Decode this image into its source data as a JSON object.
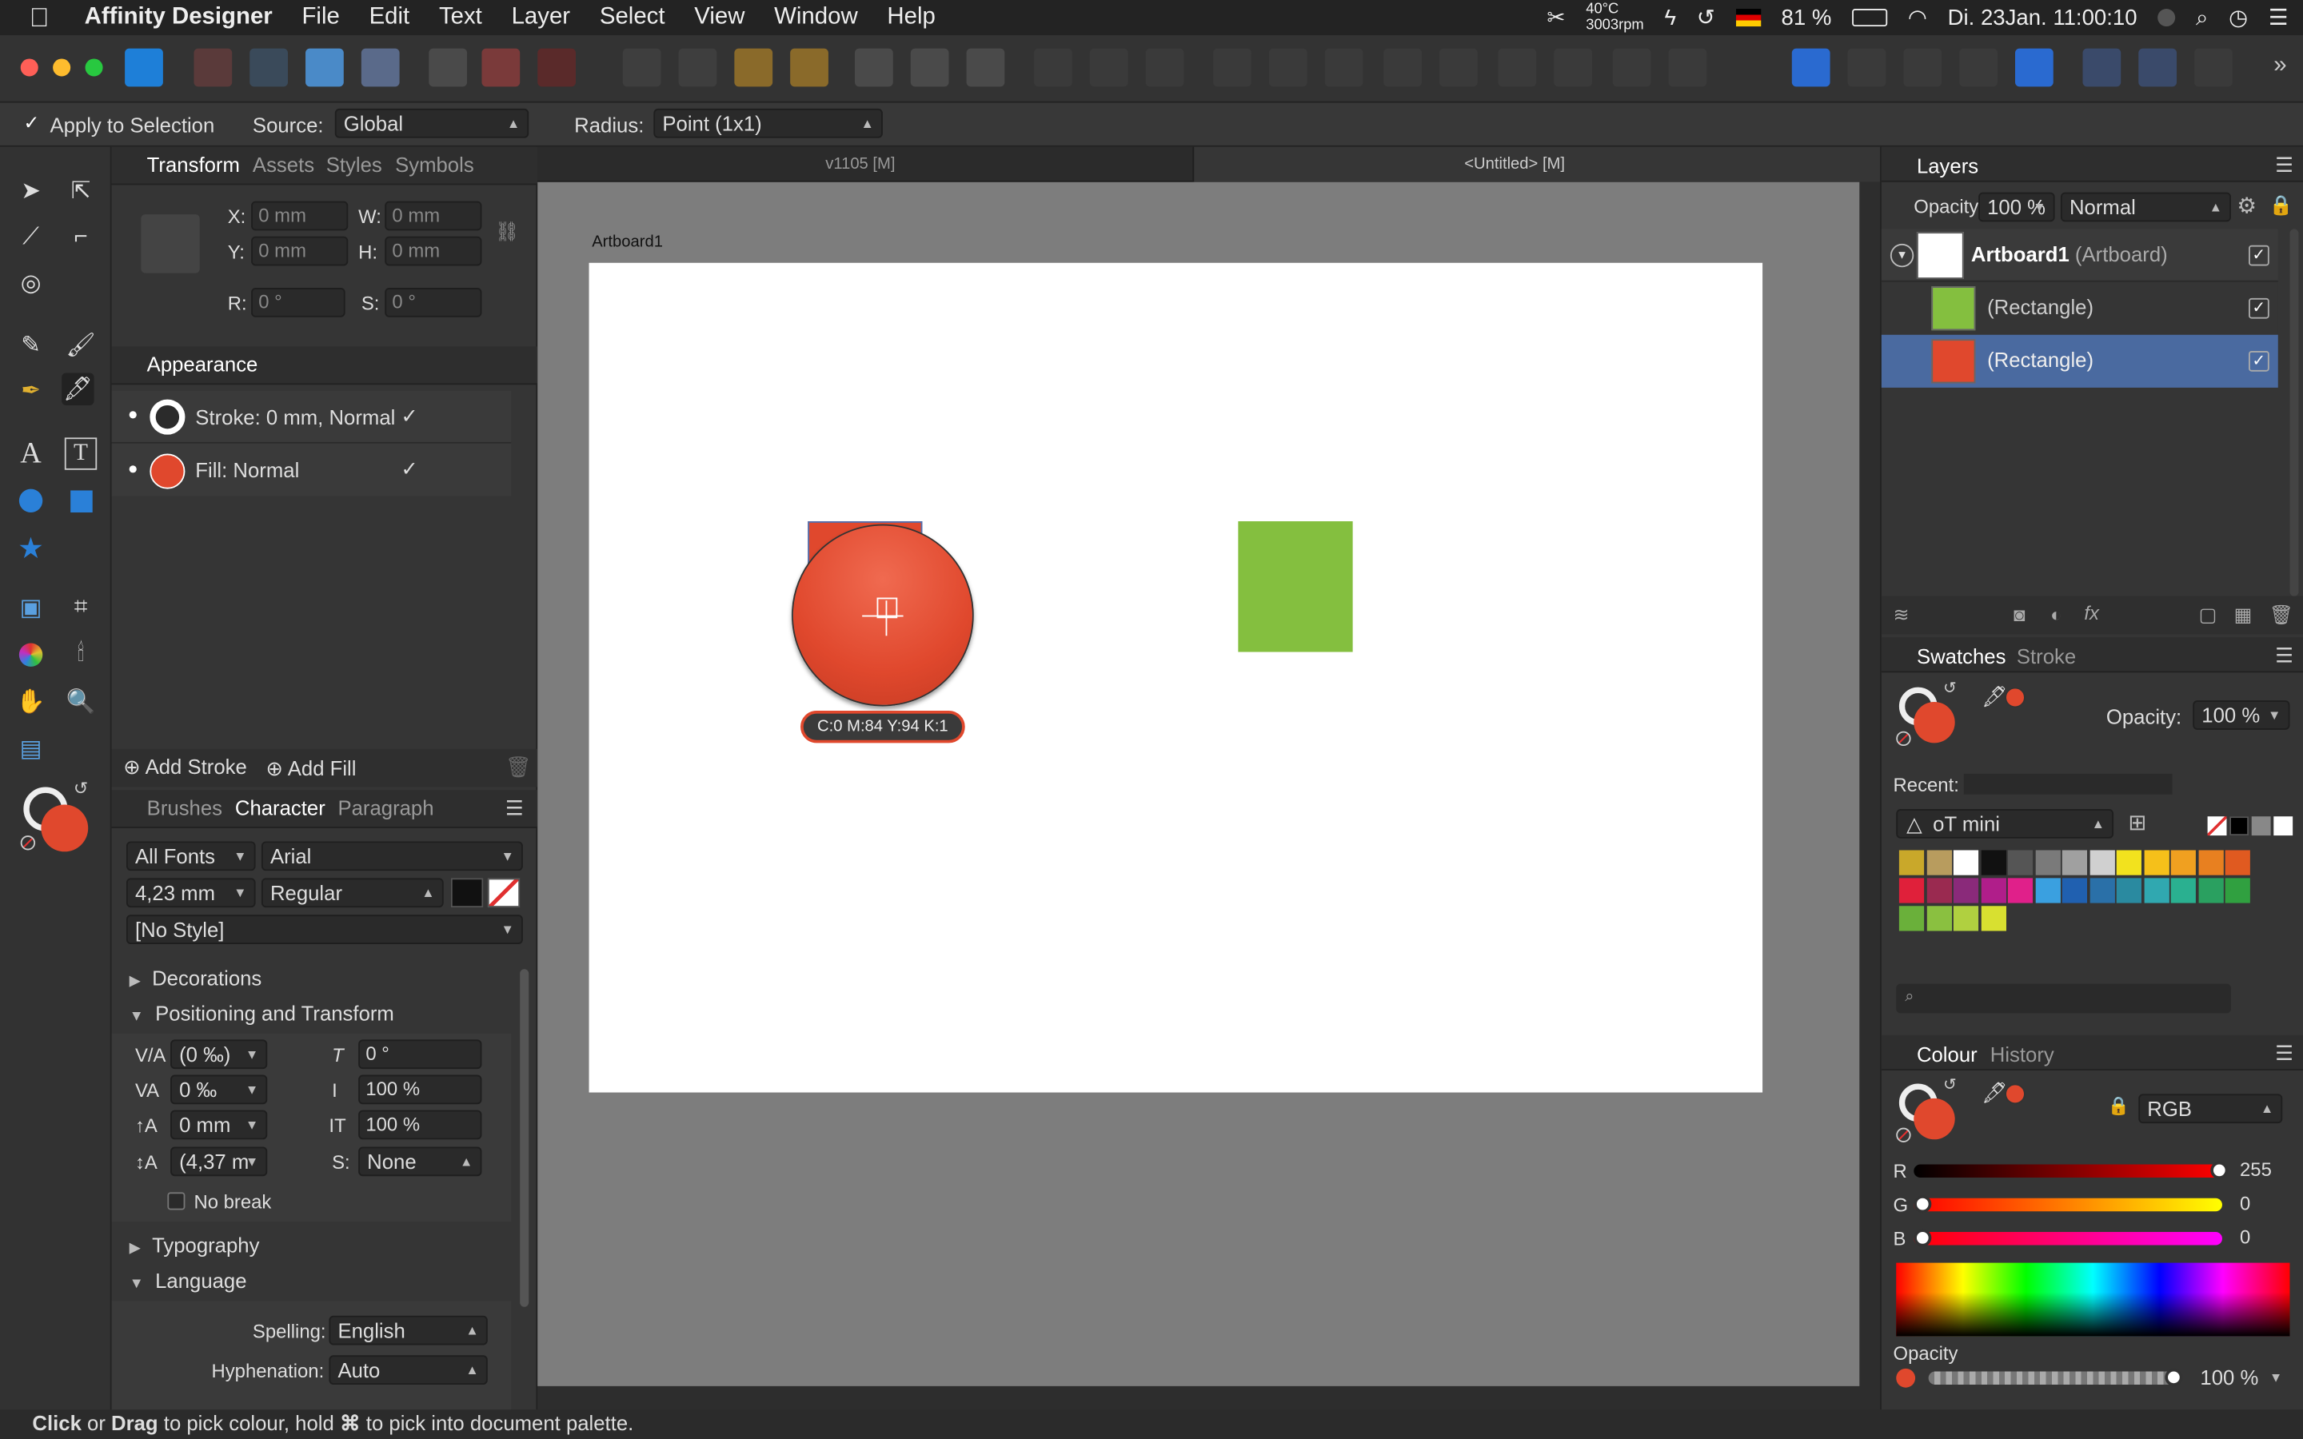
{
  "menubar": {
    "app_name": "Affinity Designer",
    "items": [
      "File",
      "Edit",
      "Text",
      "Layer",
      "Select",
      "View",
      "Window",
      "Help"
    ],
    "temp": "40°C",
    "rpm": "3003rpm",
    "battery": "81 %",
    "datetime": "Di. 23Jan.  11:00:10"
  },
  "context": {
    "apply_to_selection": "Apply to Selection",
    "source_label": "Source:",
    "source_value": "Global",
    "radius_label": "Radius:",
    "radius_value": "Point (1x1)"
  },
  "transform": {
    "tabs": [
      "Transform",
      "Assets",
      "Styles",
      "Symbols"
    ],
    "x_label": "X:",
    "x_value": "0 mm",
    "y_label": "Y:",
    "y_value": "0 mm",
    "w_label": "W:",
    "w_value": "0 mm",
    "h_label": "H:",
    "h_value": "0 mm",
    "r_label": "R:",
    "r_value": "0 °",
    "s_label": "S:",
    "s_value": "0 °"
  },
  "appearance": {
    "title": "Appearance",
    "stroke": "Stroke: 0 mm, Normal",
    "fill": "Fill: Normal",
    "add_stroke": "Add Stroke",
    "add_fill": "Add Fill"
  },
  "character": {
    "tabs": [
      "Brushes",
      "Character",
      "Paragraph"
    ],
    "font_collection": "All Fonts",
    "font": "Arial",
    "size": "4,23 mm",
    "weight": "Regular",
    "style": "[No Style]",
    "sections": {
      "decorations": "Decorations",
      "positioning": "Positioning and Transform",
      "typography": "Typography",
      "language": "Language"
    },
    "kerning": "(0 ‰)",
    "tracking": "0 ‰",
    "baseline": "0 mm",
    "leading": "(4,37 m",
    "shear": "0 °",
    "vscale": "100 %",
    "hscale": "100 %",
    "s_label": "S:",
    "s_value": "None",
    "no_break": "No break",
    "spelling_label": "Spelling:",
    "spelling_value": "English",
    "hyphenation_label": "Hyphenation:",
    "hyphenation_value": "Auto"
  },
  "document": {
    "tab1": "v1105  [M]",
    "tab2": "<Untitled> [M]",
    "artboard_name": "Artboard1",
    "picker_readout": "C:0 M:84 Y:94 K:1"
  },
  "layers": {
    "title": "Layers",
    "opacity_label": "Opacity:",
    "opacity_value": "100 %",
    "blend_mode": "Normal",
    "items": [
      {
        "name": "Artboard1",
        "type": "(Artboard)"
      },
      {
        "name": "(Rectangle)",
        "color": "#84bf3f"
      },
      {
        "name": "(Rectangle)",
        "color": "#e0482d"
      }
    ]
  },
  "swatches": {
    "tabs": [
      "Swatches",
      "Stroke"
    ],
    "opacity_label": "Opacity:",
    "opacity_value": "100 %",
    "recent_label": "Recent:",
    "palette": "oT mini",
    "colors": [
      "#c9a82a",
      "#b89c5e",
      "#ffffff",
      "#111111",
      "#555555",
      "#7a7a7a",
      "#a0a0a0",
      "#d0d0d0",
      "#f2e21e",
      "#f5c01a",
      "#f0a020",
      "#e88020",
      "#e05a20",
      "#e0203a",
      "#9a2a50",
      "#8a2a7a",
      "#b01e8a",
      "#e0208a",
      "#3aa0e0",
      "#2060b0",
      "#2a70a8",
      "#2a8aa0",
      "#30a8b0",
      "#2ab090",
      "#2aa060",
      "#30a040",
      "#6ab03a",
      "#8ac040",
      "#b0d040",
      "#d8e030"
    ]
  },
  "colour": {
    "tabs": [
      "Colour",
      "History"
    ],
    "model": "RGB",
    "r_label": "R",
    "r_value": "255",
    "g_label": "G",
    "g_value": "0",
    "b_label": "B",
    "b_value": "0",
    "opacity_label": "Opacity",
    "opacity_value": "100 %"
  },
  "statusbar": {
    "click": "Click",
    "or": " or ",
    "drag": "Drag",
    "rest1": " to pick colour, hold ",
    "cmd": "⌘",
    "rest2": " to pick into document palette."
  },
  "colors": {
    "accent_red": "#e0482d",
    "accent_green": "#84bf3f",
    "selection_blue": "#4a6aa0"
  }
}
